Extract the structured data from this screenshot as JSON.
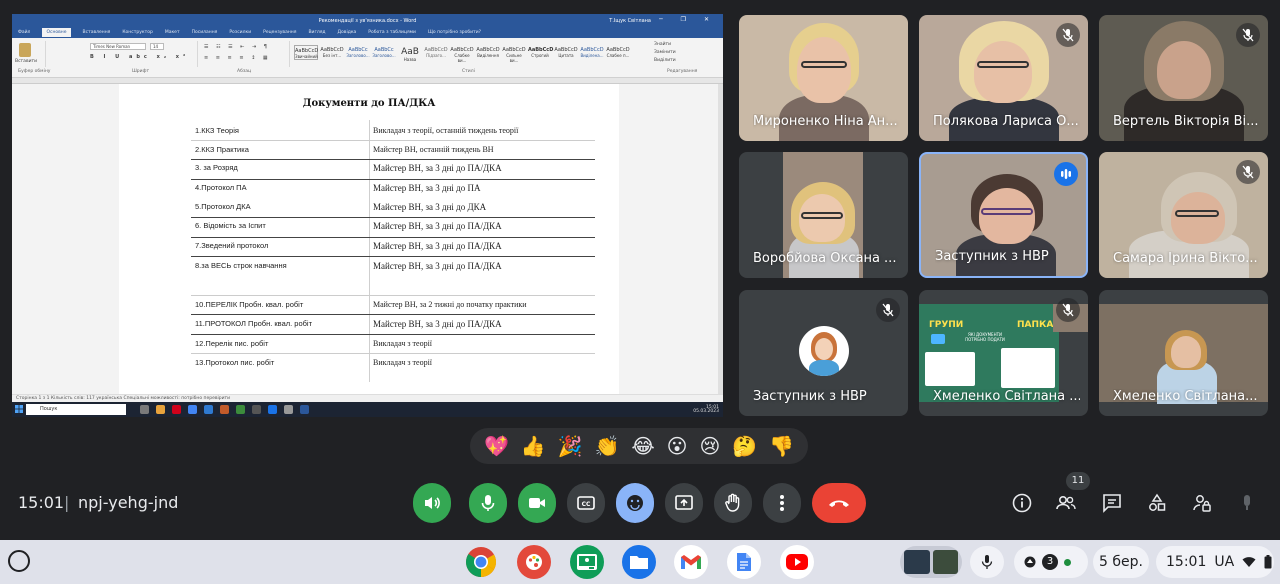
{
  "word": {
    "title": "Рекомендації з ув'язника.docx - Word",
    "user": "Т.Іщук Світлана",
    "tabs": [
      "Файл",
      "Основне",
      "Вставлення",
      "Конструктор",
      "Макет",
      "Посилання",
      "Розсилки",
      "Рецензування",
      "Вигляд",
      "Довідка",
      "Робота з таблицями",
      "Що потрібно зробити?"
    ],
    "font_name": "Times New Roman",
    "font_size": "14",
    "paste_label": "Вставити",
    "ribbon_groups": [
      "Буфер обміну",
      "Шрифт",
      "Абзац",
      "Стилі",
      "Редагування"
    ],
    "styles": [
      {
        "sample": "AaBbCcD",
        "label": "Звичайний"
      },
      {
        "sample": "AaBbCcD",
        "label": "Без інт..."
      },
      {
        "sample": "AaBbCc",
        "label": "Заголово..."
      },
      {
        "sample": "AaBbCc",
        "label": "Заголово..."
      },
      {
        "sample": "AaB",
        "label": "Назва"
      },
      {
        "sample": "AaBbCcD",
        "label": "Підзаго..."
      },
      {
        "sample": "AaBbCcD",
        "label": "Слабке ви..."
      },
      {
        "sample": "AaBbCcD",
        "label": "Виділення"
      },
      {
        "sample": "AaBbCcD",
        "label": "Сильне ви..."
      },
      {
        "sample": "AaBbCcD",
        "label": "Строгий"
      },
      {
        "sample": "AaBbCcD",
        "label": "Цитата"
      },
      {
        "sample": "AaBbCcD",
        "label": "Виділена..."
      },
      {
        "sample": "AaBbCcD",
        "label": "Слабке п..."
      }
    ],
    "edit_items": [
      "Знайти",
      "Замінити",
      "Виділити"
    ],
    "status": "Сторінка 1 з 1    Кількість слів: 117    українська    Спеціальні можливості: потрібно перевірити",
    "search_placeholder": "Пошук",
    "tray_time": "15:01",
    "tray_date": "05.03.2023",
    "doc_title": "Документи до ПА/ДКА",
    "rows": [
      {
        "doc": "1.ККЗ Теорія",
        "note": "Викладач з теорії, останній тиждень теорії"
      },
      {
        "doc": "2.ККЗ Практика",
        "note": "Майстер ВН, останній тиждень ВН"
      },
      {
        "doc": "3. за Розряд",
        "note": "Майстер ВН, за 3 дні до ПА/ДКА"
      },
      {
        "doc": "4.Протокол ПА",
        "note": "Майстер ВН, за 3 дні до ПА"
      },
      {
        "doc": "5.Протокол ДКА",
        "note": "Майстер ВН, за 3 дні до ДКА"
      },
      {
        "doc": "6. Відомість за Іспит",
        "note": "Майстер ВН, за 3 дні до ПА/ДКА"
      },
      {
        "doc": "7.Зведений протокол",
        "note": "Майстер ВН, за 3 дні до ПА/ДКА"
      },
      {
        "doc": "8.за ВЕСЬ строк навчання",
        "note": "Майстер ВН, за 3 дні до ПА/ДКА"
      },
      {
        "doc": "10.ПЕРЕЛІК Пробн. квал. робіт",
        "note": "Майстер ВН, за 2 тижні до початку практики"
      },
      {
        "doc": "11.ПРОТОКОЛ Пробн. квал. робіт",
        "note": "Майстер ВН, за 3 дні до ПА/ДКА"
      },
      {
        "doc": "12.Перелік пис. робіт",
        "note": "Викладач з теорії"
      },
      {
        "doc": "13.Протокол пис. робіт",
        "note": "Викладач з теорії"
      }
    ]
  },
  "participants": [
    {
      "name": "Мироненко Ніна Ан...",
      "muted": false
    },
    {
      "name": "Полякова Лариса О...",
      "muted": true
    },
    {
      "name": "Вертель Вікторія Ві...",
      "muted": true
    },
    {
      "name": "Воробйова Оксана ...",
      "muted": false
    },
    {
      "name": "Заступник з НВР",
      "muted": false,
      "speaking": true
    },
    {
      "name": "Самара Ірина Вікто...",
      "muted": true
    },
    {
      "name": "Заступник з НВР",
      "muted": true
    },
    {
      "name": "Хмеленко Світлана ...",
      "muted": false
    },
    {
      "name": "Хмеленко Світлана...",
      "muted": false
    }
  ],
  "slide": {
    "left": "ГРУПИ",
    "right": "ПАПКА",
    "middle": "ЯКІ ДОКУМЕНТИ ПОТРІБНО ПОДАТИ"
  },
  "reactions": [
    "💖",
    "👍",
    "🎉",
    "👏",
    "😂",
    "😮",
    "😢",
    "🤔",
    "👎"
  ],
  "meeting": {
    "time": "15:01",
    "separator": "|",
    "code": "npj-yehg-jnd",
    "people_count": "11"
  },
  "colors": {
    "accent": "#8ab4f8",
    "mic_green": "#34a853",
    "end_call": "#ea4335",
    "word_blue": "#2b579a"
  },
  "shelf": {
    "apps": [
      "chrome-icon",
      "palette-icon",
      "classroom-icon",
      "files-icon",
      "gmail-icon",
      "docs-icon",
      "youtube-icon"
    ],
    "notif_count": "3",
    "date": "5 бер.",
    "time": "15:01",
    "locale": "UA"
  }
}
